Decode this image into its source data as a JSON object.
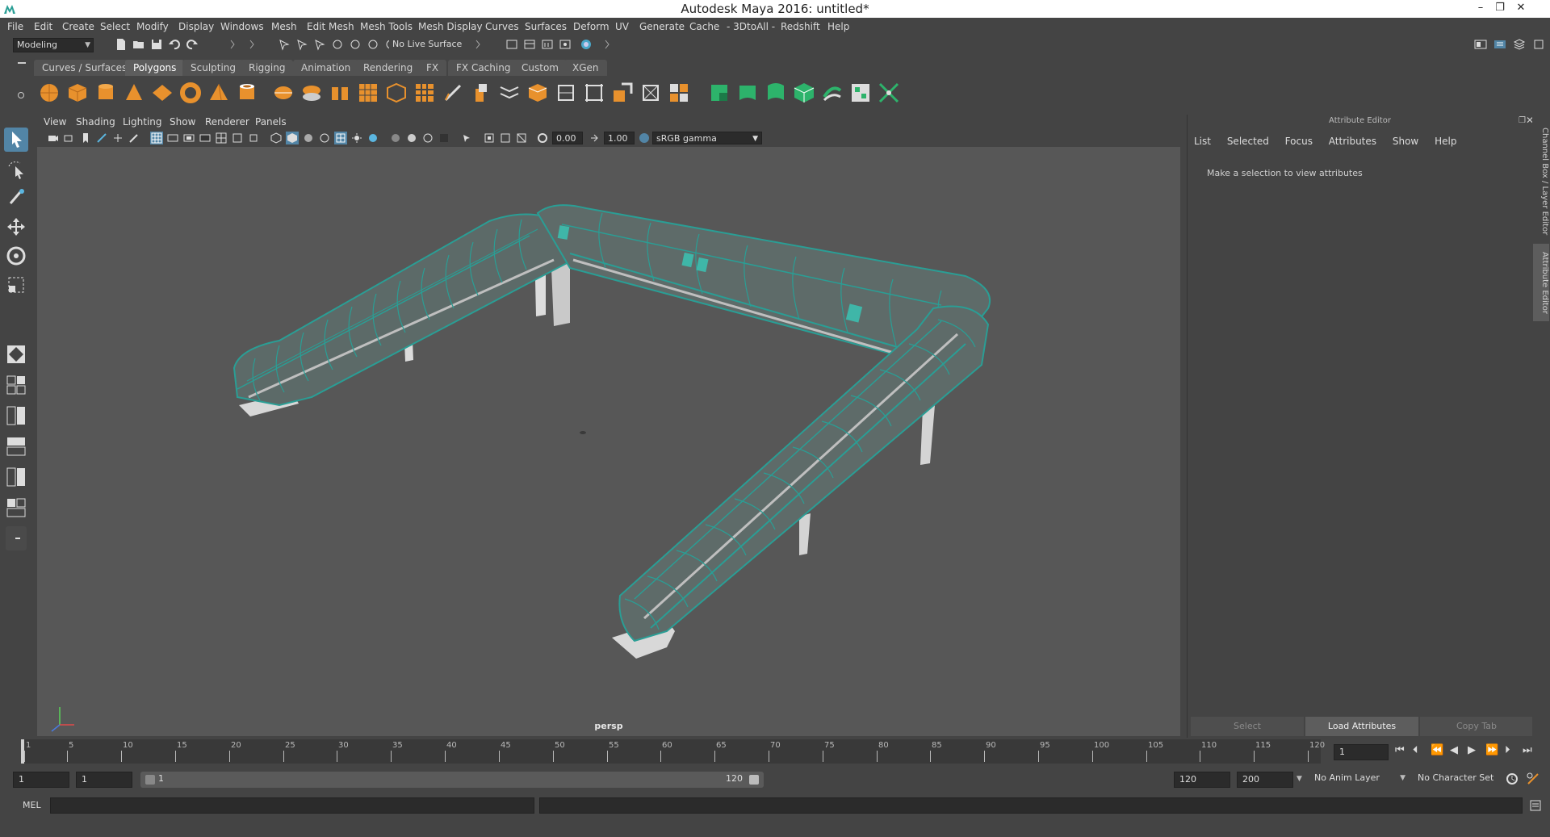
{
  "window": {
    "title": "Autodesk Maya 2016: untitled*",
    "minimize": "–",
    "restore": "❐",
    "close": "✕"
  },
  "menubar": [
    "File",
    "Edit",
    "Create",
    "Select",
    "Modify",
    "Display",
    "Windows",
    "Mesh",
    "Edit Mesh",
    "Mesh Tools",
    "Mesh Display",
    "Curves",
    "Surfaces",
    "Deform",
    "UV",
    "Generate",
    "Cache",
    "- 3DtoAll -",
    "Redshift",
    "Help"
  ],
  "statusline": {
    "mode": "Modeling",
    "live_surface": "No Live Surface"
  },
  "shelf": {
    "tabs": [
      "Curves / Surfaces",
      "Polygons",
      "Sculpting",
      "Rigging",
      "Animation",
      "Rendering",
      "FX",
      "FX Caching",
      "Custom",
      "XGen"
    ],
    "active_tab": "Polygons"
  },
  "viewport": {
    "menu": [
      "View",
      "Shading",
      "Lighting",
      "Show",
      "Renderer",
      "Panels"
    ],
    "exposure": "0.00",
    "gamma": "1.00",
    "color_space": "sRGB gamma",
    "camera": "persp"
  },
  "attribute_editor": {
    "header": "Attribute Editor",
    "menu": [
      "List",
      "Selected",
      "Focus",
      "Attributes",
      "Show",
      "Help"
    ],
    "message": "Make a selection to view attributes",
    "buttons": {
      "select": "Select",
      "load": "Load Attributes",
      "copy": "Copy Tab"
    }
  },
  "side_tabs": {
    "channel_box": "Channel Box / Layer Editor",
    "attribute_editor": "Attribute Editor"
  },
  "timeslider": {
    "labels": [
      "1",
      "5",
      "10",
      "15",
      "20",
      "25",
      "30",
      "35",
      "40",
      "45",
      "50",
      "55",
      "60",
      "65",
      "70",
      "75",
      "80",
      "85",
      "90",
      "95",
      "100",
      "105",
      "110",
      "115",
      "120"
    ],
    "current_frame": "1"
  },
  "range": {
    "start": "1",
    "playback_start": "1",
    "slider_start": "1",
    "slider_end": "120",
    "playback_end": "120",
    "end": "200",
    "anim_layer": "No Anim Layer",
    "character_set": "No Character Set"
  },
  "cmdline": {
    "lang": "MEL"
  },
  "colors": {
    "accent": "#5285a6",
    "wireframe": "#2a9e95",
    "viewport_bg": "#575757",
    "ui_bg": "#444444"
  }
}
